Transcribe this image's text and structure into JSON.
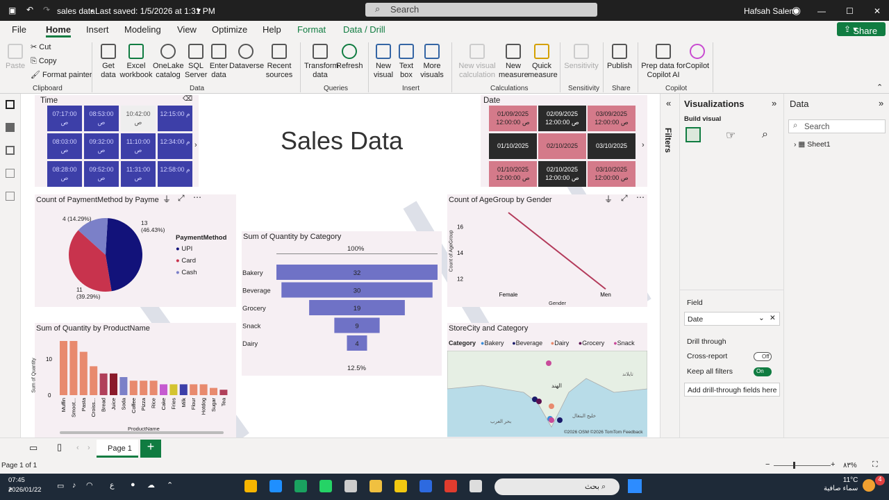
{
  "titlebar": {
    "file_name": "sales data",
    "saved": "Last saved: 1/5/2026 at 1:31 PM",
    "search_placeholder": "Search",
    "user": "Hafsah Salem"
  },
  "menu": {
    "tabs": [
      "File",
      "Home",
      "Insert",
      "Modeling",
      "View",
      "Optimize",
      "Help",
      "Format",
      "Data / Drill"
    ]
  },
  "ribbon": {
    "clipboard": {
      "paste": "Paste",
      "cut": "Cut",
      "copy": "Copy",
      "format_painter": "Format painter",
      "group": "Clipboard"
    },
    "data": {
      "get_data": "Get data",
      "excel": "Excel workbook",
      "onelake": "OneLake catalog",
      "sql": "SQL Server",
      "enter": "Enter data",
      "dataverse": "Dataverse",
      "recent": "Recent sources",
      "group": "Data"
    },
    "queries": {
      "transform": "Transform data",
      "refresh": "Refresh",
      "group": "Queries"
    },
    "insert": {
      "new_visual": "New visual",
      "text_box": "Text box",
      "more_visuals": "More visuals",
      "group": "Insert"
    },
    "calculations": {
      "new_visual_calc": "New visual calculation",
      "new_measure": "New measure",
      "quick_measure": "Quick measure",
      "group": "Calculations"
    },
    "sensitivity": {
      "label": "Sensitivity",
      "group": "Sensitivity"
    },
    "share": {
      "publish": "Publish",
      "group": "Share"
    },
    "copilot": {
      "prep": "Prep data for Copilot AI",
      "copilot": "Copilot",
      "group": "Copilot"
    },
    "share_button": "Share"
  },
  "time_slicer": {
    "title": "Time",
    "cells": [
      [
        "07:17:00\nص",
        "08:53:00\nص",
        "10:42:00\nص",
        "12:15:00 م"
      ],
      [
        "08:03:00\nص",
        "09:32:00\nص",
        "11:10:00\nص",
        "12:34:00 م"
      ],
      [
        "08:28:00\nص",
        "09:52:00\nص",
        "11:31:00\nص",
        "12:58:00 م"
      ]
    ]
  },
  "banner": {
    "title": "Sales Data",
    "color": "#d9606f"
  },
  "date_slicer": {
    "title": "Date",
    "cells": [
      [
        "01/09/2025\n12:00:00 ص",
        "02/09/2025\n12:00:00 ص",
        "03/09/2025\n12:00:00 ص"
      ],
      [
        "01/10/2025",
        "02/10/2025",
        "03/10/2025"
      ],
      [
        "01/10/2025\n12:00:00 ص",
        "02/10/2025\n12:00:00 ص",
        "03/10/2025\n12:00:00 ص"
      ]
    ]
  },
  "pie": {
    "title": "Count of PaymentMethod by Payme",
    "legend_title": "PaymentMethod",
    "labels": [
      "13\n(46.43%)",
      "11\n(39.29%)",
      "4 (14.29%)"
    ],
    "chart_data": {
      "type": "pie",
      "categories": [
        "UPI",
        "Card",
        "Cash"
      ],
      "values": [
        13,
        11,
        4
      ],
      "colors": [
        "#12127a",
        "#c8334d",
        "#7b80c8"
      ]
    }
  },
  "funnel": {
    "title": "Sum of Quantity by Category",
    "top_label": "100%",
    "bottom_label": "12.5%",
    "chart_data": {
      "type": "bar",
      "categories": [
        "Bakery",
        "Beverage",
        "Grocery",
        "Snack",
        "Dairy"
      ],
      "values": [
        32,
        30,
        19,
        9,
        4
      ]
    }
  },
  "line": {
    "title": "Count of AgeGroup by Gender",
    "ylabel": "Count of AgeGroup",
    "xlabel": "Gender",
    "ticks": [
      "16",
      "14",
      "12"
    ],
    "chart_data": {
      "type": "line",
      "categories": [
        "Female",
        "Men"
      ],
      "values": [
        17.1,
        11.2
      ],
      "ylim": [
        11,
        17
      ]
    }
  },
  "bars": {
    "title": "Sum of Quantity by ProductName",
    "ylabel": "Sum of Quantity",
    "xlabel": "ProductName",
    "ticks": [
      "10",
      "0"
    ],
    "chart_data": {
      "type": "bar",
      "categories": [
        "Muffin",
        "Smoot...",
        "Pasta",
        "Croiss...",
        "Bread",
        "Juice",
        "Soda",
        "Coffee",
        "Pizza",
        "Rice",
        "Cake",
        "Fries",
        "Milk",
        "Flour",
        "Hotdog",
        "Sugar",
        "Tea"
      ],
      "values": [
        15,
        15,
        12,
        8,
        6,
        6,
        5,
        4,
        4,
        4,
        3,
        3,
        3,
        3,
        3,
        2,
        1.5
      ],
      "colors": [
        "#e88a6e",
        "#e88a6e",
        "#e88a6e",
        "#e88a6e",
        "#b0405a",
        "#8a1a2a",
        "#7b80c8",
        "#e88a6e",
        "#e88a6e",
        "#e88a6e",
        "#c55ad0",
        "#d4c430",
        "#3d3fa8",
        "#e88a6e",
        "#e88a6e",
        "#e88a6e",
        "#b0405a"
      ]
    }
  },
  "map": {
    "title": "StoreCity and Category",
    "legend_title": "Category",
    "legend": [
      {
        "name": "Bakery",
        "color": "#3a8bd8"
      },
      {
        "name": "Beverage",
        "color": "#1a1a6a"
      },
      {
        "name": "Dairy",
        "color": "#e88a6e"
      },
      {
        "name": "Grocery",
        "color": "#5a1050"
      },
      {
        "name": "Snack",
        "color": "#c84b9a"
      }
    ],
    "attribution": "©2026 OSM  ©2026 TomTom  Feedback",
    "place_labels": [
      "الهند",
      "بحر العرب",
      "خليج البنغال",
      "تايلاند"
    ]
  },
  "filters": {
    "label": "Filters"
  },
  "viz": {
    "title": "Visualizations",
    "build": "Build visual",
    "field_label": "Field",
    "field_value": "Date",
    "drill": "Drill through",
    "cross": "Cross-report",
    "cross_state": "Off",
    "keep": "Keep all filters",
    "keep_state": "On",
    "add": "Add drill-through fields here"
  },
  "data": {
    "title": "Data",
    "search": "Search",
    "table": "Sheet1"
  },
  "pages": {
    "page": "Page 1",
    "status": "Page 1 of 1",
    "zoom": "٨٣%"
  },
  "taskbar": {
    "time": "07:45\nم",
    "date": "2026/01/22",
    "weather": "11°C\nسماء صافية",
    "search": "بحث",
    "lang": "ع",
    "badge": "4"
  }
}
